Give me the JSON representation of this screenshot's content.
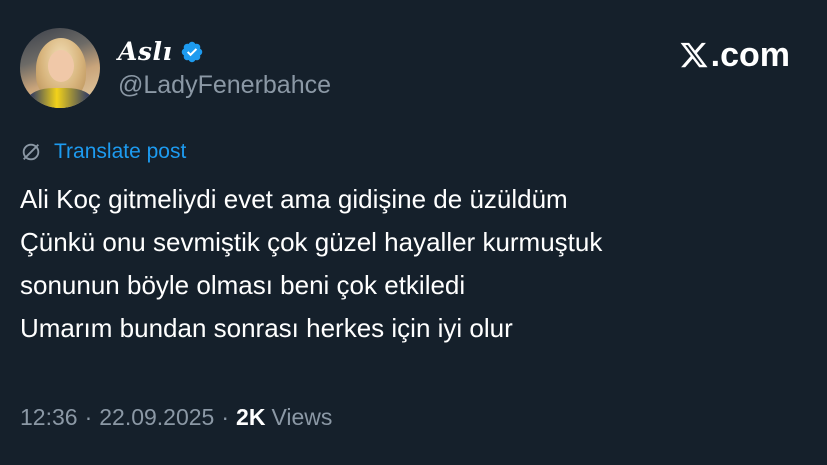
{
  "author": {
    "display_name": "Aslı",
    "handle": "@LadyFenerbahce",
    "verified": true,
    "avatar": "profile-photo"
  },
  "brand": {
    "logo_text": ".com",
    "logo_icon": "x-logo-icon"
  },
  "translate": {
    "label": "Translate post",
    "icon": "globe-slash-icon"
  },
  "post": {
    "lines": [
      "Ali Koç gitmeliydi evet ama gidişine de üzüldüm",
      "Çünkü onu sevmiştik çok güzel hayaller kurmuştuk",
      "sonunun böyle olması beni çok etkiledi",
      "Umarım bundan sonrası herkes için iyi olur"
    ]
  },
  "meta": {
    "time": "12:36",
    "separator": "·",
    "date": "22.09.2025",
    "views_count": "2K",
    "views_label": "Views"
  },
  "colors": {
    "background": "#15202b",
    "text": "#ffffff",
    "secondary": "#8b98a5",
    "accent": "#1d9bf0"
  }
}
